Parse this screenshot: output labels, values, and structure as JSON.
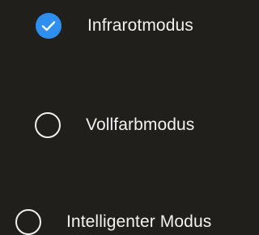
{
  "options": [
    {
      "label": "Infrarotmodus",
      "selected": true,
      "icon": "check-icon"
    },
    {
      "label": "Vollfarbmodus",
      "selected": false,
      "icon": "radio-empty-icon"
    },
    {
      "label": "Intelligenter Modus",
      "selected": false,
      "icon": "radio-empty-icon"
    }
  ],
  "colors": {
    "background": "#211f1b",
    "accent": "#2f8ff0",
    "text": "#f2f2f2"
  }
}
